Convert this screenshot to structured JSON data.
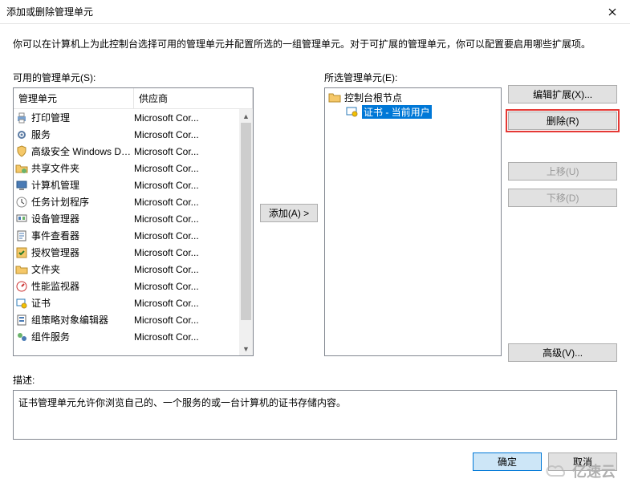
{
  "window": {
    "title": "添加或删除管理单元"
  },
  "intro": "你可以在计算机上为此控制台选择可用的管理单元并配置所选的一组管理单元。对于可扩展的管理单元，你可以配置要启用哪些扩展项。",
  "available": {
    "label": "可用的管理单元(S):",
    "columns": {
      "name": "管理单元",
      "vendor": "供应商"
    },
    "items": [
      {
        "icon": "printer",
        "name": "打印管理",
        "vendor": "Microsoft Cor..."
      },
      {
        "icon": "gear",
        "name": "服务",
        "vendor": "Microsoft Cor..."
      },
      {
        "icon": "shield",
        "name": "高级安全 Windows De...",
        "vendor": "Microsoft Cor..."
      },
      {
        "icon": "folder-sh",
        "name": "共享文件夹",
        "vendor": "Microsoft Cor..."
      },
      {
        "icon": "computer",
        "name": "计算机管理",
        "vendor": "Microsoft Cor..."
      },
      {
        "icon": "clock",
        "name": "任务计划程序",
        "vendor": "Microsoft Cor..."
      },
      {
        "icon": "device",
        "name": "设备管理器",
        "vendor": "Microsoft Cor..."
      },
      {
        "icon": "event",
        "name": "事件查看器",
        "vendor": "Microsoft Cor..."
      },
      {
        "icon": "auth",
        "name": "授权管理器",
        "vendor": "Microsoft Cor..."
      },
      {
        "icon": "folder",
        "name": "文件夹",
        "vendor": "Microsoft Cor..."
      },
      {
        "icon": "perf",
        "name": "性能监视器",
        "vendor": "Microsoft Cor..."
      },
      {
        "icon": "cert",
        "name": "证书",
        "vendor": "Microsoft Cor..."
      },
      {
        "icon": "gpo",
        "name": "组策略对象编辑器",
        "vendor": "Microsoft Cor..."
      },
      {
        "icon": "comsvc",
        "name": "组件服务",
        "vendor": "Microsoft Cor..."
      }
    ]
  },
  "add_button": "添加(A) >",
  "selected": {
    "label": "所选管理单元(E):",
    "root": {
      "icon": "folder",
      "label": "控制台根节点"
    },
    "child": {
      "icon": "cert-blue",
      "label": "证书 - 当前用户",
      "selected": true
    }
  },
  "buttons": {
    "edit_ext": "编辑扩展(X)...",
    "remove": "删除(R)",
    "move_up": "上移(U)",
    "move_dn": "下移(D)",
    "advanced": "高级(V)..."
  },
  "description": {
    "label": "描述:",
    "text": "证书管理单元允许你浏览自己的、一个服务的或一台计算机的证书存储内容。"
  },
  "footer": {
    "ok": "确定",
    "cancel": "取消"
  },
  "watermark": "亿速云"
}
